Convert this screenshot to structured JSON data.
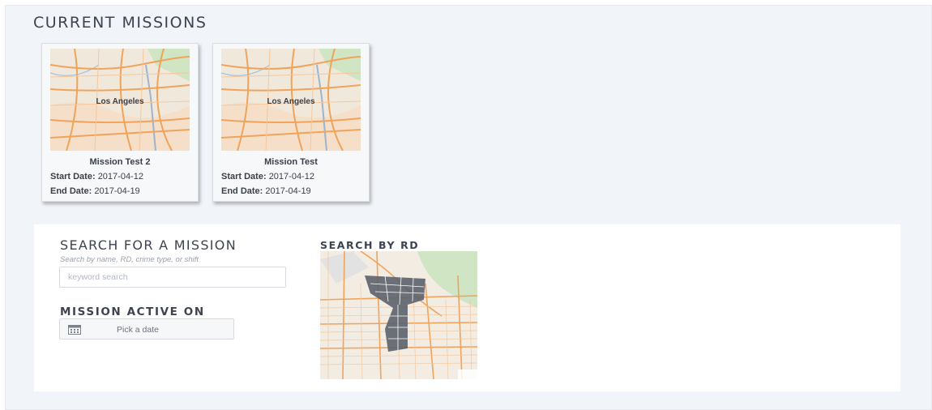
{
  "current_missions": {
    "title": "CURRENT MISSIONS",
    "cards": [
      {
        "name": "Mission Test 2",
        "start_label": "Start Date:",
        "start_date": "2017-04-12",
        "end_label": "End Date:",
        "end_date": "2017-04-19",
        "map_city": "Los Angeles"
      },
      {
        "name": "Mission Test",
        "start_label": "Start Date:",
        "start_date": "2017-04-12",
        "end_label": "End Date:",
        "end_date": "2017-04-19",
        "map_city": "Los Angeles"
      }
    ]
  },
  "search": {
    "title": "SEARCH FOR A MISSION",
    "hint": "Search by name, RD, crime type, or shift",
    "placeholder": "keyword search",
    "active_on_title": "MISSION ACTIVE ON",
    "date_button_label": "Pick a date",
    "rd_title": "SEARCH BY RD"
  },
  "icons": {
    "calendar": "calendar-icon"
  },
  "colors": {
    "panel_bg": "#f1f4f8",
    "map_roads": "#f0a35a",
    "map_land": "#efe6da",
    "rd_regions": "#5c626c"
  }
}
